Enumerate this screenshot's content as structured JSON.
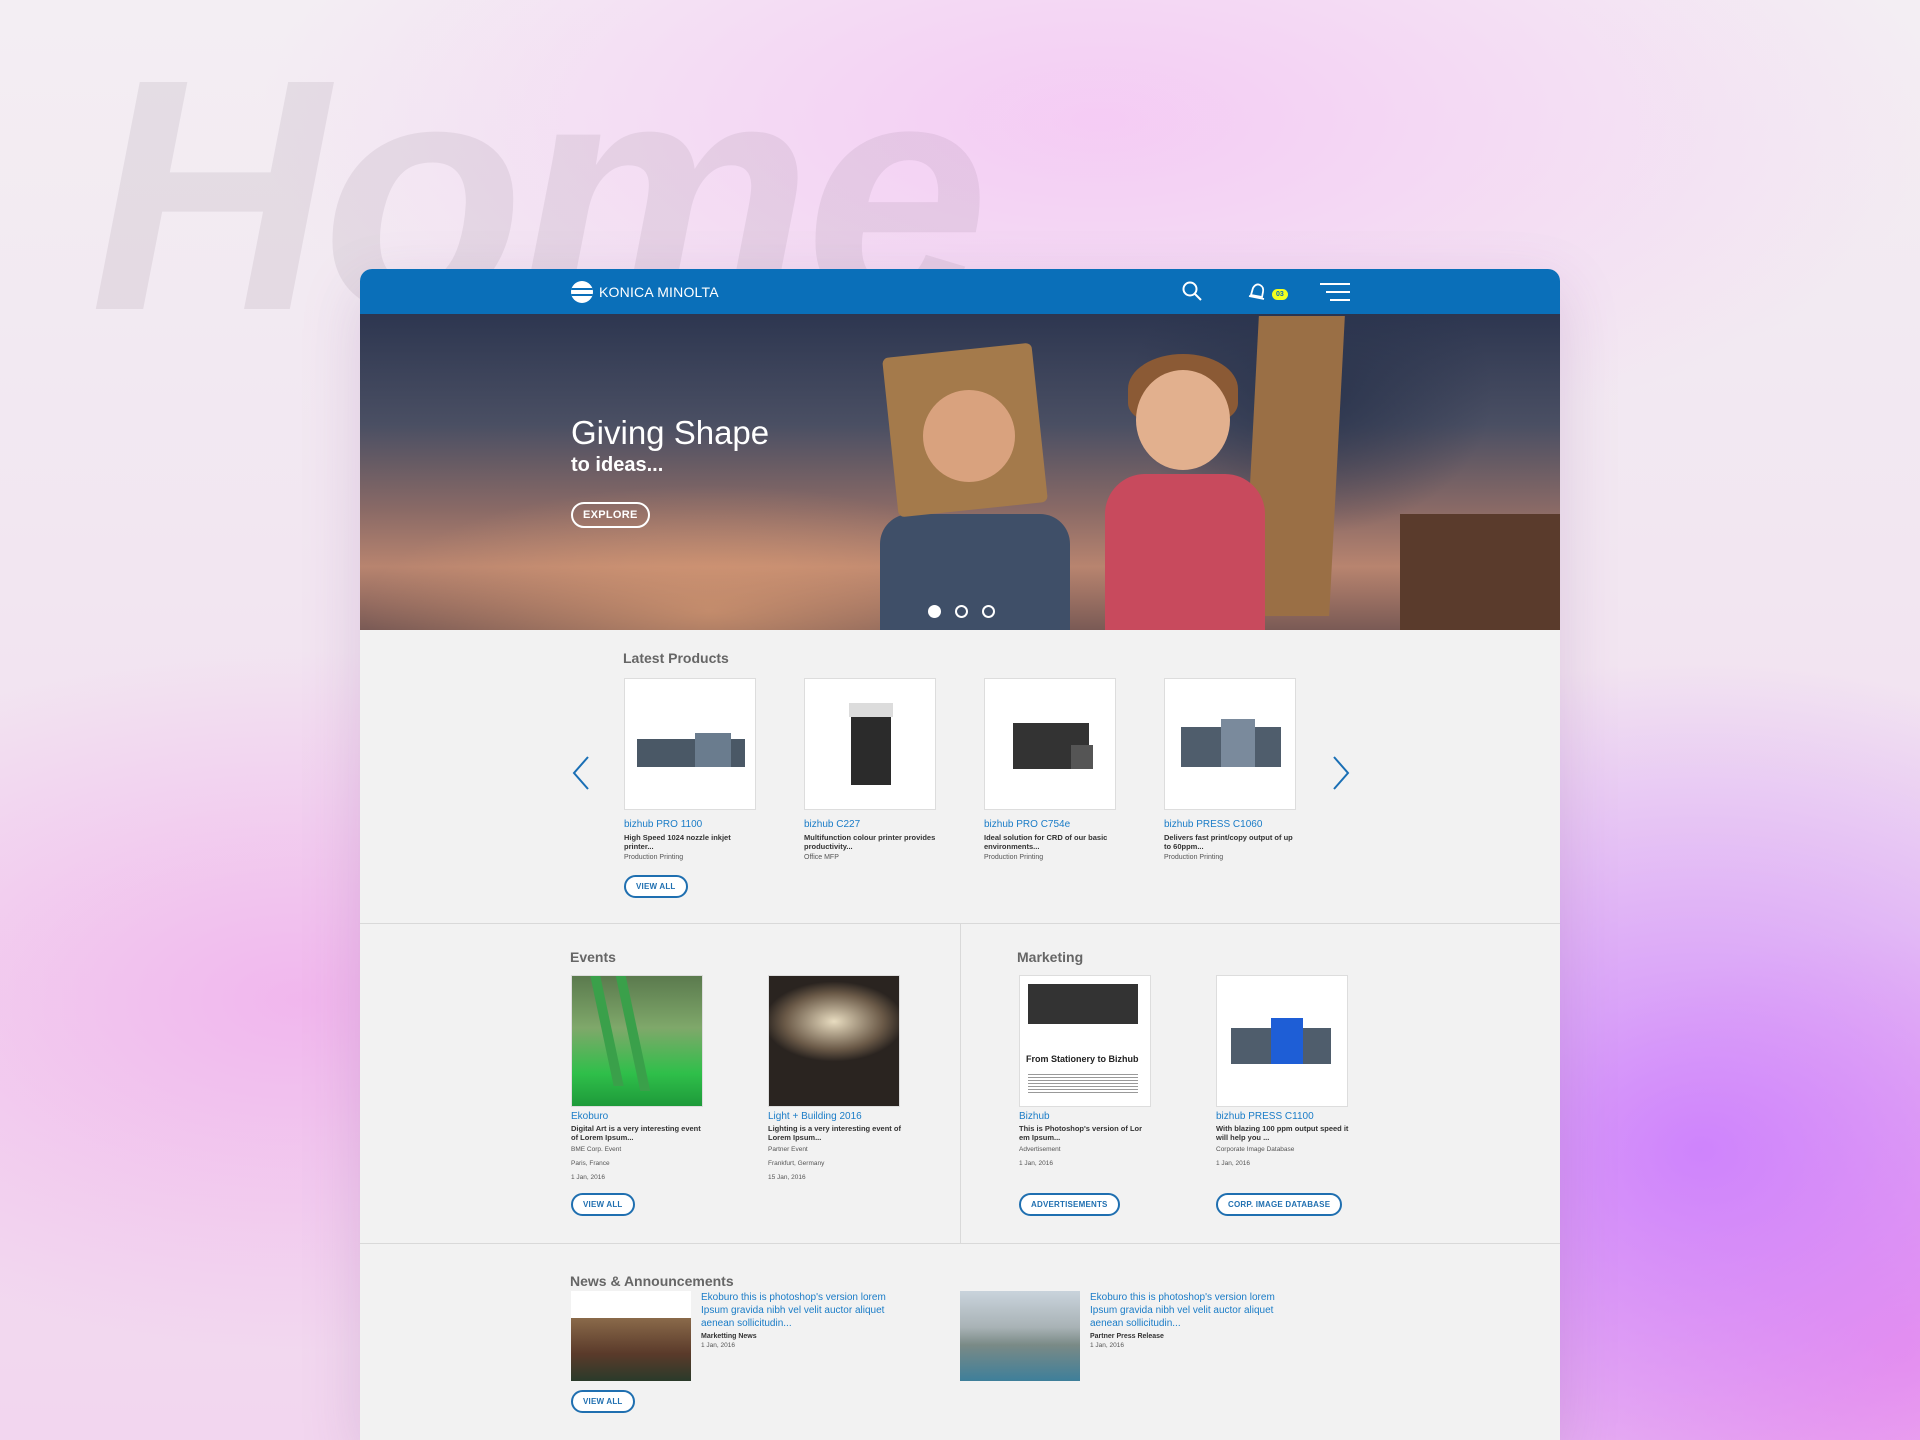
{
  "background_title": "Home",
  "colors": {
    "brand_blue": "#0a6fb9",
    "link_blue": "#1a7cc7",
    "badge_yellow": "#f2ff1f"
  },
  "header": {
    "logo_text": "KONICA MINOLTA",
    "notification_count": "03",
    "icons": [
      "search-icon",
      "bell-icon",
      "menu-icon"
    ]
  },
  "hero": {
    "title": "Giving Shape",
    "subtitle": "to ideas...",
    "button_label": "EXPLORE",
    "slides": 3,
    "active_slide": 1
  },
  "latest_products": {
    "title": "Latest Products",
    "view_all_label": "VIEW ALL",
    "items": [
      {
        "name": "bizhub PRO 1100",
        "desc": "High Speed 1024 nozzle inkjet printer...",
        "category": "Production Printing"
      },
      {
        "name": "bizhub C227",
        "desc": "Multifunction colour printer provides productivity...",
        "category": "Office MFP"
      },
      {
        "name": "bizhub PRO C754e",
        "desc": "Ideal solution for CRD of our basic environments...",
        "category": "Production Printing"
      },
      {
        "name": "bizhub PRESS C1060",
        "desc": "Delivers fast print/copy output of up to 60ppm...",
        "category": "Production Printing"
      }
    ]
  },
  "events": {
    "title": "Events",
    "view_all_label": "VIEW ALL",
    "items": [
      {
        "name": "Ekoburo",
        "desc": "Digital Art is a very interesting event of Lorem Ipsum...",
        "organizer": "BME Corp. Event",
        "location": "Paris, France",
        "date": "1 Jan, 2016"
      },
      {
        "name": "Light + Building 2016",
        "desc": "Lighting is a very interesting event of Lorem Ipsum...",
        "organizer": "Partner Event",
        "location": "Frankfurt, Germany",
        "date": "15 Jan, 2016"
      }
    ]
  },
  "marketing": {
    "title": "Marketing",
    "items": [
      {
        "name": "Bizhub",
        "desc": "This is Photoshop's version of Lor em Ipsum...",
        "type": "Advertisement",
        "date": "1 Jan, 2016",
        "button_label": "ADVERTISEMENTS",
        "thumb_caption": "From Stationery to Bizhub"
      },
      {
        "name": "bizhub PRESS C1100",
        "desc": "With blazing 100 ppm output speed it will help you ...",
        "type": "Corporate Image Database",
        "date": "1 Jan, 2016",
        "button_label": "CORP. IMAGE DATABASE"
      }
    ]
  },
  "news": {
    "title": "News & Announcements",
    "view_all_label": "VIEW ALL",
    "items": [
      {
        "title": "Ekoburo this is photoshop's version lorem Ipsum gravida nibh vel velit auctor aliquet aenean sollicitudin...",
        "category": "Marketting News",
        "date": "1 Jan, 2016"
      },
      {
        "title": "Ekoburo this is photoshop's version lorem Ipsum gravida nibh vel velit auctor aliquet aenean sollicitudin...",
        "category": "Partner Press Release",
        "date": "1 Jan, 2016"
      }
    ]
  }
}
